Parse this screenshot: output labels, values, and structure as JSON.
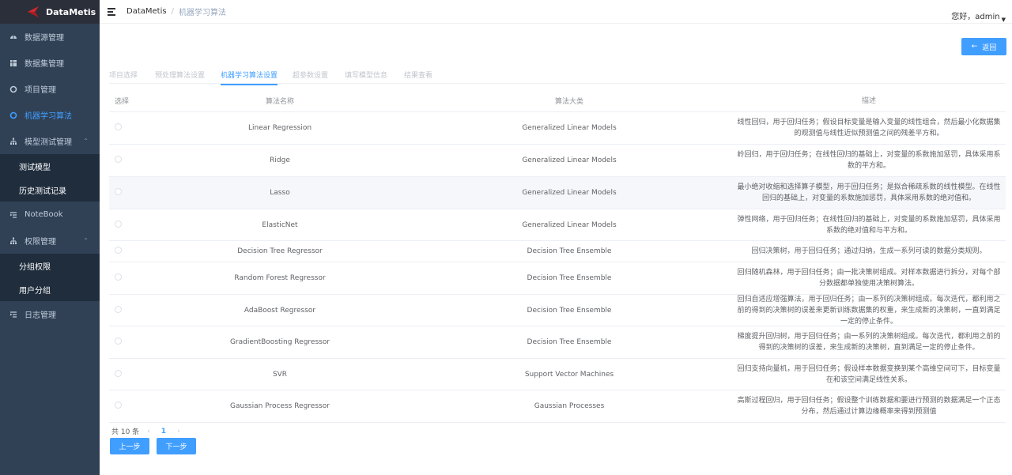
{
  "app": {
    "brand": "DataMetis",
    "brand_color": "#d9272e"
  },
  "sidebar": {
    "items": [
      {
        "label": "数据源管理",
        "icon": "dashboard-icon"
      },
      {
        "label": "数据集管理",
        "icon": "table-icon"
      },
      {
        "label": "项目管理",
        "icon": "circle-icon"
      },
      {
        "label": "机器学习算法",
        "icon": "circle-icon",
        "active": true
      },
      {
        "label": "模型测试管理",
        "icon": "tree-icon",
        "expanded": true,
        "children": [
          "测试模型",
          "历史测试记录"
        ]
      },
      {
        "label": "NoteBook",
        "icon": "list-icon"
      },
      {
        "label": "权限管理",
        "icon": "tree-icon",
        "expanded": true,
        "children": [
          "分组权限",
          "用户分组"
        ]
      },
      {
        "label": "日志管理",
        "icon": "list-icon"
      }
    ]
  },
  "header": {
    "breadcrumb_root": "DataMetis",
    "breadcrumb_sep": "/",
    "breadcrumb_current": "机器学习算法",
    "user": "您好，admin"
  },
  "main": {
    "back_label": "返回",
    "steps": [
      "项目选择",
      "预处理算法设置",
      "机器学习算法设置",
      "超参数设置",
      "填写模型信息",
      "结果查看"
    ],
    "active_step": 2,
    "table": {
      "headers": [
        "选择",
        "算法名称",
        "算法大类",
        "描述"
      ],
      "rows": [
        {
          "name": "Linear Regression",
          "category": "Generalized Linear Models",
          "desc": "线性回归，用于回归任务；假设目标变量是输入变量的线性组合，然后最小化数据集的观测值与线性近似预测值之间的残差平方和。"
        },
        {
          "name": "Ridge",
          "category": "Generalized Linear Models",
          "desc": "岭回归，用于回归任务；在线性回归的基础上，对变量的系数施加惩罚，具体采用系数的平方和。"
        },
        {
          "name": "Lasso",
          "category": "Generalized Linear Models",
          "desc": "最小绝对收缩和选择算子模型，用于回归任务；是拟合稀疏系数的线性模型。在线性回归的基础上，对变量的系数施加惩罚，具体采用系数的绝对值和。"
        },
        {
          "name": "ElasticNet",
          "category": "Generalized Linear Models",
          "desc": "弹性网络，用于回归任务；在线性回归的基础上，对变量的系数施加惩罚，具体采用系数的绝对值和与平方和。"
        },
        {
          "name": "Decision Tree Regressor",
          "category": "Decision Tree Ensemble",
          "desc": "回归决策树，用于回归任务；通过归纳，生成一系列可读的数据分类规则。"
        },
        {
          "name": "Random Forest Regressor",
          "category": "Decision Tree Ensemble",
          "desc": "回归随机森林，用于回归任务；由一批决策树组成。对样本数据进行拆分，对每个部分数据都单独使用决策树算法。"
        },
        {
          "name": "AdaBoost Regressor",
          "category": "Decision Tree Ensemble",
          "desc": "回归自适应增强算法，用于回归任务；由一系列的决策树组成。每次迭代，都利用之前的得到的决策树的误差来更新训练数据集的权重，来生成新的决策树，一直到满足一定的停止条件。"
        },
        {
          "name": "GradientBoosting Regressor",
          "category": "Decision Tree Ensemble",
          "desc": "梯度提升回归树，用于回归任务；由一系列的决策树组成。每次迭代，都利用之前的得到的决策树的误差，来生成新的决策树，直到满足一定的停止条件。"
        },
        {
          "name": "SVR",
          "category": "Support Vector Machines",
          "desc": "回归支持向量机，用于回归任务；假设样本数据变换到某个高维空间可下，目标变量在和该空间满足线性关系。"
        },
        {
          "name": "Gaussian Process Regressor",
          "category": "Gaussian Processes",
          "desc": "高斯过程回归，用于回归任务；假设整个训练数据和要进行预测的数据满足一个正态分布，然后通过计算边缘概率来得到预测值"
        }
      ]
    },
    "pagination": {
      "total_label": "共 10 条",
      "prev": "‹",
      "page": "1",
      "next": "›"
    },
    "prev_button": "上一步",
    "next_button": "下一步"
  }
}
